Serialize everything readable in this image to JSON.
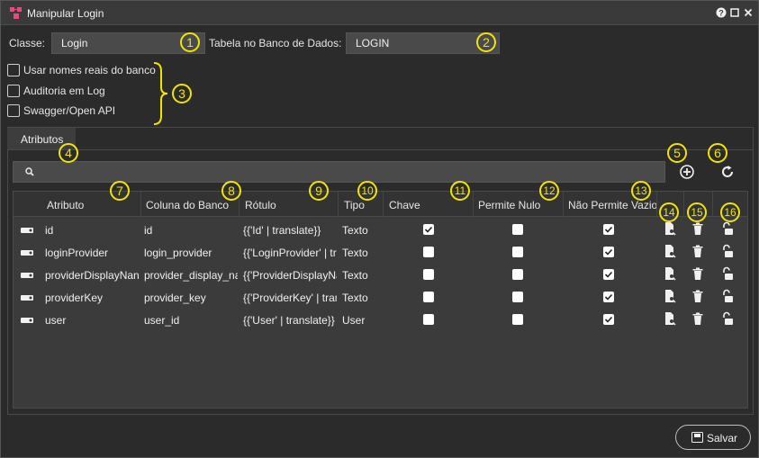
{
  "window": {
    "title": "Manipular Login",
    "controls": {
      "help": "?",
      "maximize": "□",
      "close": "✕"
    }
  },
  "form": {
    "class_label": "Classe:",
    "class_value": "Login",
    "table_label": "Tabela no Banco de Dados:",
    "table_value": "LOGIN"
  },
  "options": [
    {
      "label": "Usar nomes reais do banco",
      "checked": false
    },
    {
      "label": "Auditoria em Log",
      "checked": false
    },
    {
      "label": "Swagger/Open API",
      "checked": false
    }
  ],
  "tabs": [
    {
      "label": "Atributos",
      "active": true
    }
  ],
  "search": {
    "placeholder": ""
  },
  "grid": {
    "columns": [
      "Atributo",
      "Coluna do Banco",
      "Rótulo",
      "Tipo",
      "Chave",
      "Permite Nulo",
      "Não Permite Vazio"
    ],
    "rows": [
      {
        "atributo": "id",
        "coluna": "id",
        "rotulo": "{{'Id' | translate}}",
        "tipo": "Texto",
        "chave": true,
        "permite_nulo": false,
        "nao_permite_vazio": true
      },
      {
        "atributo": "loginProvider",
        "coluna": "login_provider",
        "rotulo": "{{'LoginProvider' | tr",
        "tipo": "Texto",
        "chave": false,
        "permite_nulo": false,
        "nao_permite_vazio": true
      },
      {
        "atributo": "providerDisplayNan",
        "coluna": "provider_display_na",
        "rotulo": "{{'ProviderDisplayNa",
        "tipo": "Texto",
        "chave": false,
        "permite_nulo": false,
        "nao_permite_vazio": true
      },
      {
        "atributo": "providerKey",
        "coluna": "provider_key",
        "rotulo": "{{'ProviderKey' | tran",
        "tipo": "Texto",
        "chave": false,
        "permite_nulo": false,
        "nao_permite_vazio": true
      },
      {
        "atributo": "user",
        "coluna": "user_id",
        "rotulo": "{{'User' | translate}}",
        "tipo": "User",
        "chave": false,
        "permite_nulo": false,
        "nao_permite_vazio": true
      }
    ]
  },
  "annotations": [
    "1",
    "2",
    "3",
    "4",
    "5",
    "6",
    "7",
    "8",
    "9",
    "10",
    "11",
    "12",
    "13",
    "14",
    "15",
    "16"
  ],
  "footer": {
    "save_label": "Salvar"
  },
  "colors": {
    "annotation": "#f2e400",
    "background": "#2b2b2b",
    "field": "#4a4a4a"
  },
  "icons": [
    "app-icon",
    "help-icon",
    "maximize-icon",
    "close-icon",
    "search-icon",
    "add-circle-icon",
    "refresh-icon",
    "key-row-icon",
    "edit-document-icon",
    "trash-icon",
    "unlock-icon",
    "save-icon"
  ]
}
